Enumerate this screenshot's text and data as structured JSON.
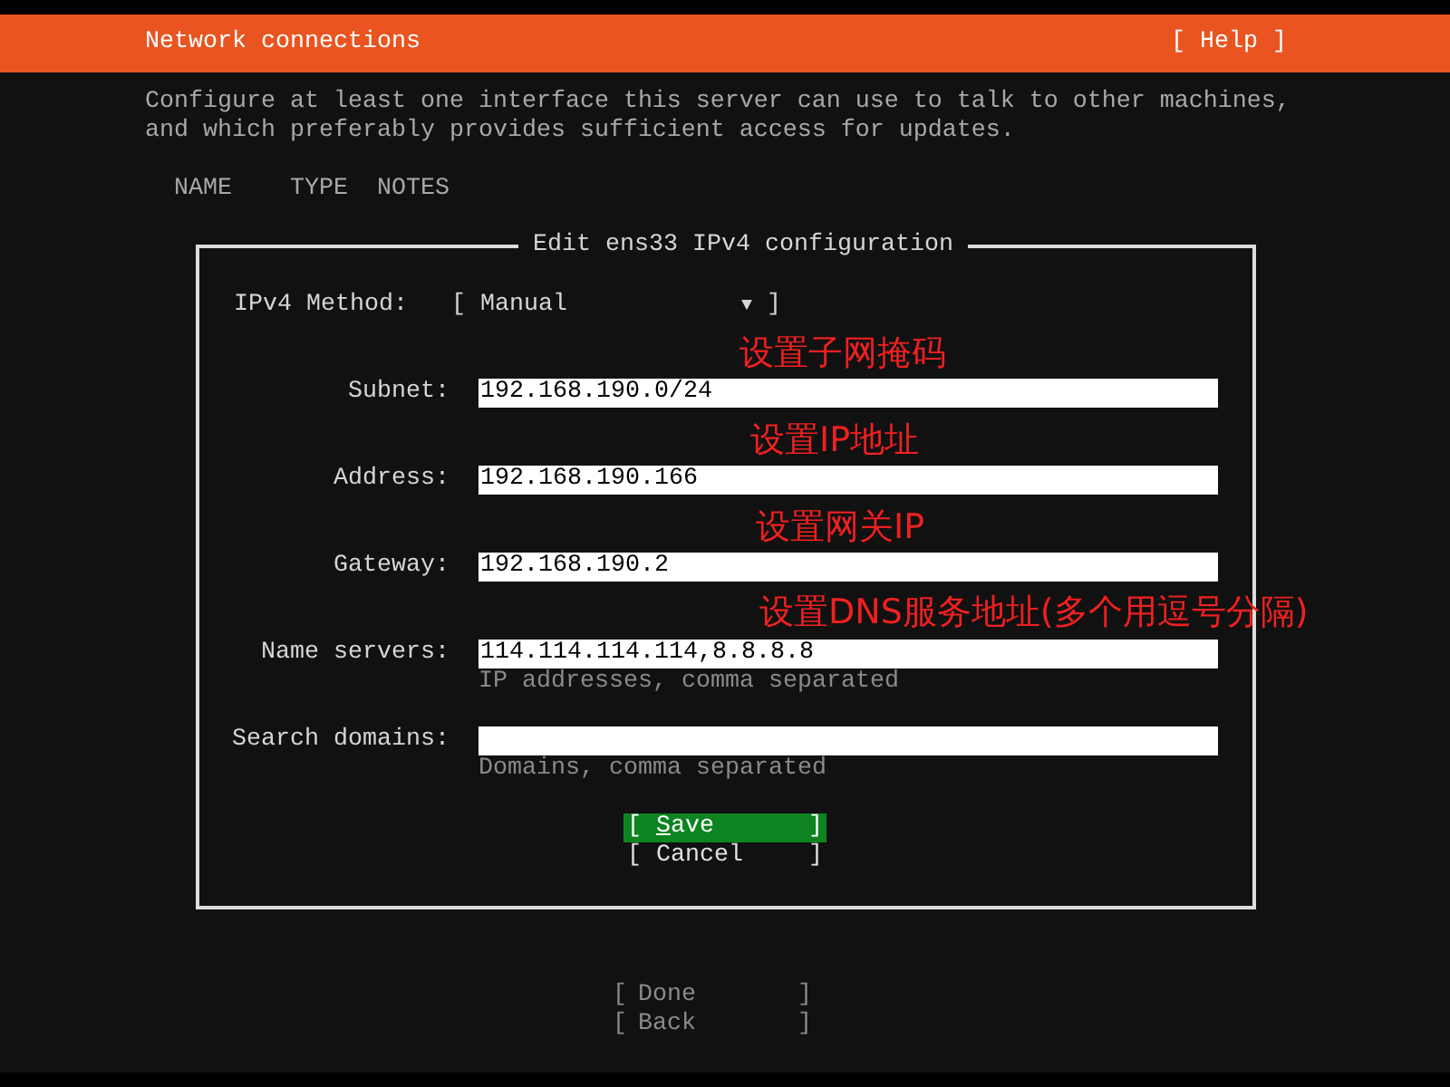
{
  "header": {
    "title": "Network connections",
    "help": "[ Help ]"
  },
  "description": [
    "Configure at least one interface this server can use to talk to other machines,",
    "and which preferably provides sufficient access for updates."
  ],
  "columns": [
    "NAME",
    "TYPE",
    "NOTES"
  ],
  "dialog": {
    "title": "Edit ens33 IPv4 configuration",
    "method": {
      "label": "IPv4 Method:",
      "value": "Manual",
      "brackets": [
        "[",
        "]"
      ],
      "arrow": "▼"
    },
    "fields": [
      {
        "label": "Subnet:",
        "value": "192.168.190.0/24"
      },
      {
        "label": "Address:",
        "value": "192.168.190.166"
      },
      {
        "label": "Gateway:",
        "value": "192.168.190.2"
      },
      {
        "label": "Name servers:",
        "value": "114.114.114.114,8.8.8.8",
        "hint": "IP addresses, comma separated"
      },
      {
        "label": "Search domains:",
        "hint": "Domains, comma separated"
      }
    ],
    "buttons": [
      {
        "label": "Save",
        "brackets": [
          "[",
          "]"
        ],
        "selected": true,
        "hotkey_underlined": true
      },
      {
        "label": "Cancel",
        "brackets": [
          "[",
          "]"
        ],
        "selected": false,
        "hotkey_underlined": false
      }
    ]
  },
  "footer_buttons": [
    {
      "label": "Done",
      "brackets": [
        "[",
        "]"
      ],
      "disabled": true
    },
    {
      "label": "Back",
      "brackets": [
        "[",
        "]"
      ],
      "disabled": true
    }
  ],
  "annotations": [
    "设置子网掩码",
    "设置IP地址",
    "设置网关IP",
    "设置DNS服务地址(多个用逗号分隔)"
  ]
}
